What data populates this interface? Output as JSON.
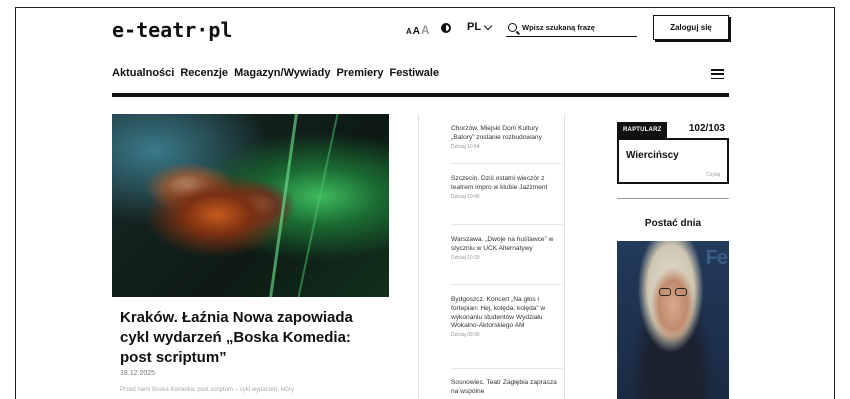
{
  "header": {
    "logo": "e-teatr·pl",
    "font_sizes": [
      "A",
      "A",
      "A"
    ],
    "language": "PL",
    "search_placeholder": "Wpisz szukaną frazę",
    "login_label": "Zaloguj się"
  },
  "nav": {
    "items": [
      "Aktualności",
      "Recenzje",
      "Magazyn/Wywiady",
      "Premiery",
      "Festiwale"
    ]
  },
  "hero": {
    "title": "Kraków. Łaźnia Nowa zapowiada cykl wydarzeń „Boska Komedia: post scriptum”",
    "date": "18.12.2025",
    "lead": "Przed nami Boska Komedia: post scriptum – cykl wydarzeń, który"
  },
  "news": [
    {
      "text": "Chorzów. Miejski Dom Kultury „Batory” zostanie rozbudowany",
      "time": "Dzisiaj 10:54"
    },
    {
      "text": "Szczecin. Dziś ostatni wieczór z teatrem impro w klubie Jazzment",
      "time": "Dzisiaj 10:46"
    },
    {
      "text": "Warszawa. „Dwoje na huśtawce” w styczniu w UCK Alternatywy",
      "time": "Dzisiaj 10:39"
    },
    {
      "text": "Bydgoszcz. Koncert „Na głos i fortepian: Hej, kolęda, kolęda” w wykonaniu studentów Wydziału Wokalno-Aktorskiego AM",
      "time": "Dzisiaj 09:56"
    },
    {
      "text": "Sosnowiec. Teatr Zagłębia zaprasza na wspólne",
      "time": ""
    }
  ],
  "raptularz": {
    "tag": "RAPTULARZ",
    "count": "102/103",
    "name": "Wiercińscy",
    "author": "Czytaj"
  },
  "postac": {
    "title": "Postać dnia",
    "image_text": "Fe"
  },
  "colors": {
    "text": "#111111",
    "muted": "#999999",
    "background": "#ffffff"
  }
}
